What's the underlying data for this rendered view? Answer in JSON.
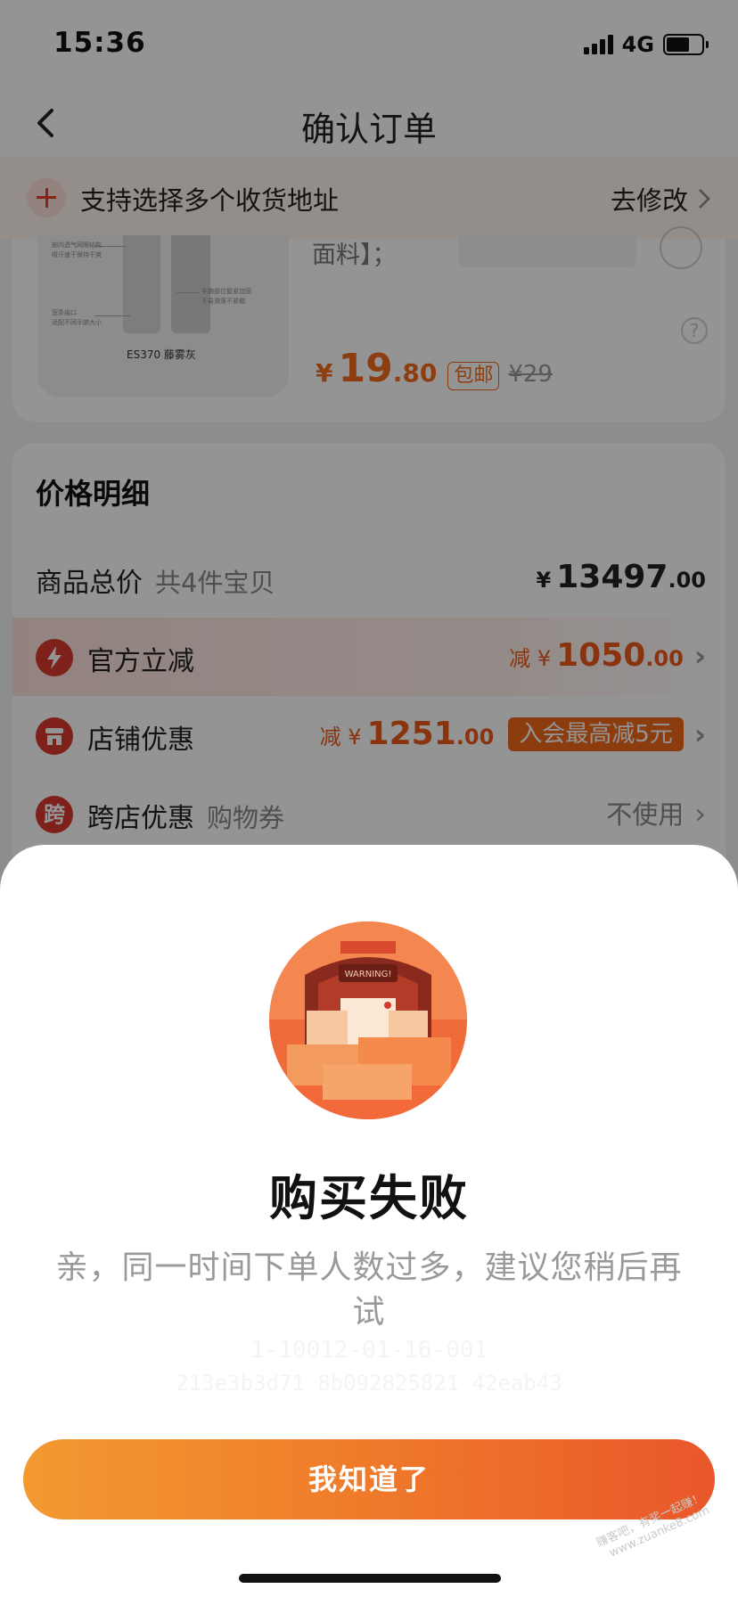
{
  "status_bar": {
    "time": "15:36",
    "network": "4G",
    "battery_level": 0.65
  },
  "nav": {
    "title": "确认订单"
  },
  "address_banner": {
    "text": "支持选择多个收货地址",
    "edit_label": "去修改"
  },
  "product": {
    "desc_fragment": "面料】；",
    "image_caption": "ES370 藤雾灰",
    "image_notes": [
      "剖内透气网眼结构",
      "吸汗速干保持干爽",
      "宽条袖口",
      "适配不同手腕大小",
      "手腕部位握紧加固",
      "不易滑落不紧绷"
    ],
    "price_symbol": "¥",
    "price_int": "19",
    "price_dec": ".80",
    "shipping_tag": "包邮",
    "original_price": "¥29"
  },
  "price_detail": {
    "title": "价格明细",
    "total": {
      "label": "商品总价",
      "sub": "共4件宝贝",
      "symbol": "¥",
      "int": "13497",
      "dec": ".00"
    },
    "official_discount": {
      "icon": "lightning-icon",
      "label": "官方立减",
      "prefix": "减 ¥",
      "int": "1050",
      "dec": ".00"
    },
    "store_discount": {
      "icon": "store-icon",
      "label": "店铺优惠",
      "prefix": "减 ¥",
      "int": "1251",
      "dec": ".00",
      "tag": "入会最高减5元"
    },
    "cross_store": {
      "icon_text": "跨",
      "label": "跨店优惠",
      "sub": "购物券",
      "value": "不使用"
    }
  },
  "dialog": {
    "title": "购买失败",
    "message": "亲，同一时间下单人数过多，建议您稍后再试",
    "trace_line1": "1-10012-01-16-001",
    "trace_line2": "213e3b3d71 8b092825821 42eab43",
    "button_label": "我知道了",
    "illustration_sign": "WARNING!"
  },
  "watermark": {
    "line1": "赚客吧，有奖一起赚！",
    "line2": "www.zuanke8.com"
  },
  "colors": {
    "accent": "#f36b1c",
    "discount": "#ec5b1a",
    "button_start": "#f29a31",
    "button_end": "#e9572b"
  }
}
